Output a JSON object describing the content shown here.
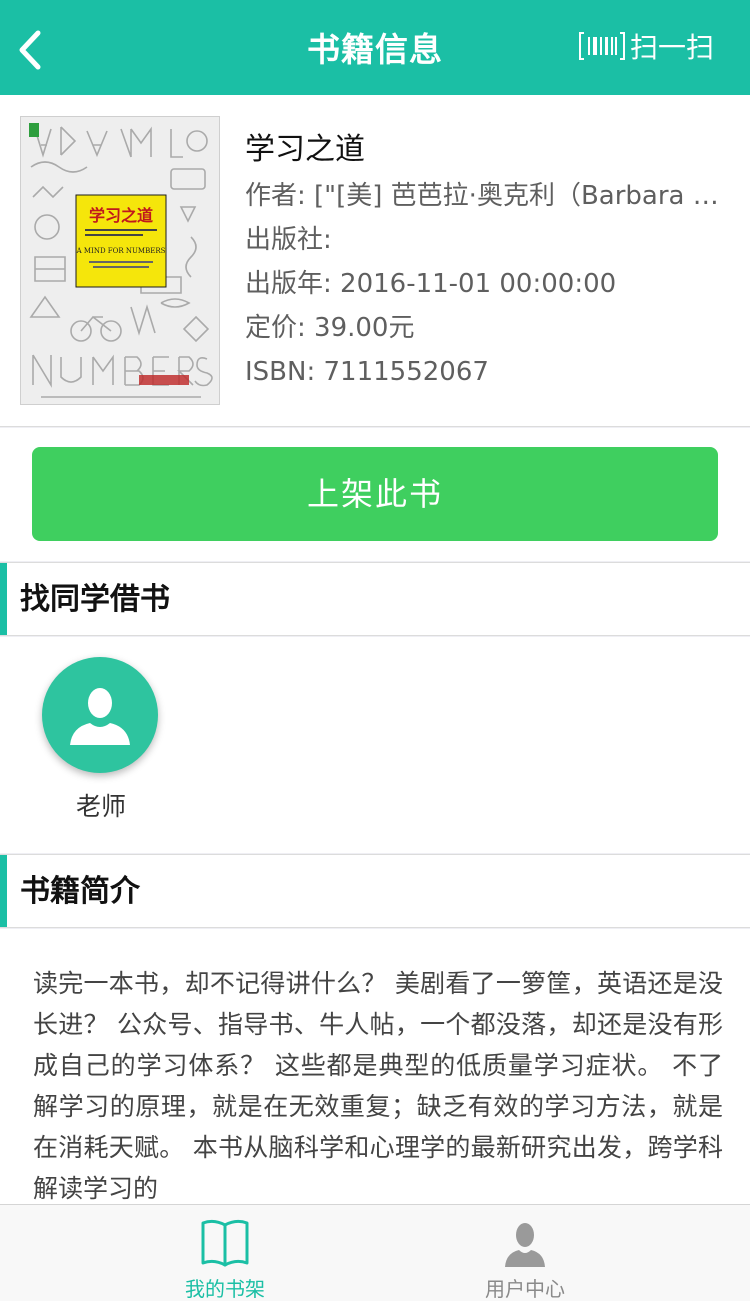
{
  "nav": {
    "title": "书籍信息",
    "scan_label": "扫一扫",
    "back_icon": "chevron-left-icon",
    "scan_icon": "barcode-icon"
  },
  "book": {
    "title": "学习之道",
    "author": "作者: [\"[美] 芭芭拉·奥克利（Barbara Oakley）",
    "publisher": "出版社:",
    "publish_year": "出版年: 2016-11-01 00:00:00",
    "price": "定价: 39.00元",
    "isbn": "ISBN: 7111552067",
    "cover": {
      "title": "学习之道",
      "subtitle_en": "A MIND FOR NUMBERS"
    }
  },
  "actions": {
    "shelf_button": "上架此书"
  },
  "borrow": {
    "header": "找同学借书",
    "users": [
      {
        "name": "老师"
      }
    ]
  },
  "summary": {
    "header": "书籍简介",
    "text": "读完一本书，却不记得讲什么？ 美剧看了一箩筐，英语还是没长进？ 公众号、指导书、牛人帖，一个都没落，却还是没有形成自己的学习体系？ 这些都是典型的低质量学习症状。 不了解学习的原理，就是在无效重复；缺乏有效的学习方法，就是在消耗天赋。 本书从脑科学和心理学的最新研究出发，跨学科解读学习的"
  },
  "tabbar": {
    "tabs": [
      {
        "label": "我的书架",
        "icon": "book-icon",
        "active": true
      },
      {
        "label": "用户中心",
        "icon": "user-icon",
        "active": false
      }
    ]
  },
  "colors": {
    "primary": "#1bbfa5",
    "button": "#3fcf5f",
    "avatar": "#2ec49f"
  }
}
